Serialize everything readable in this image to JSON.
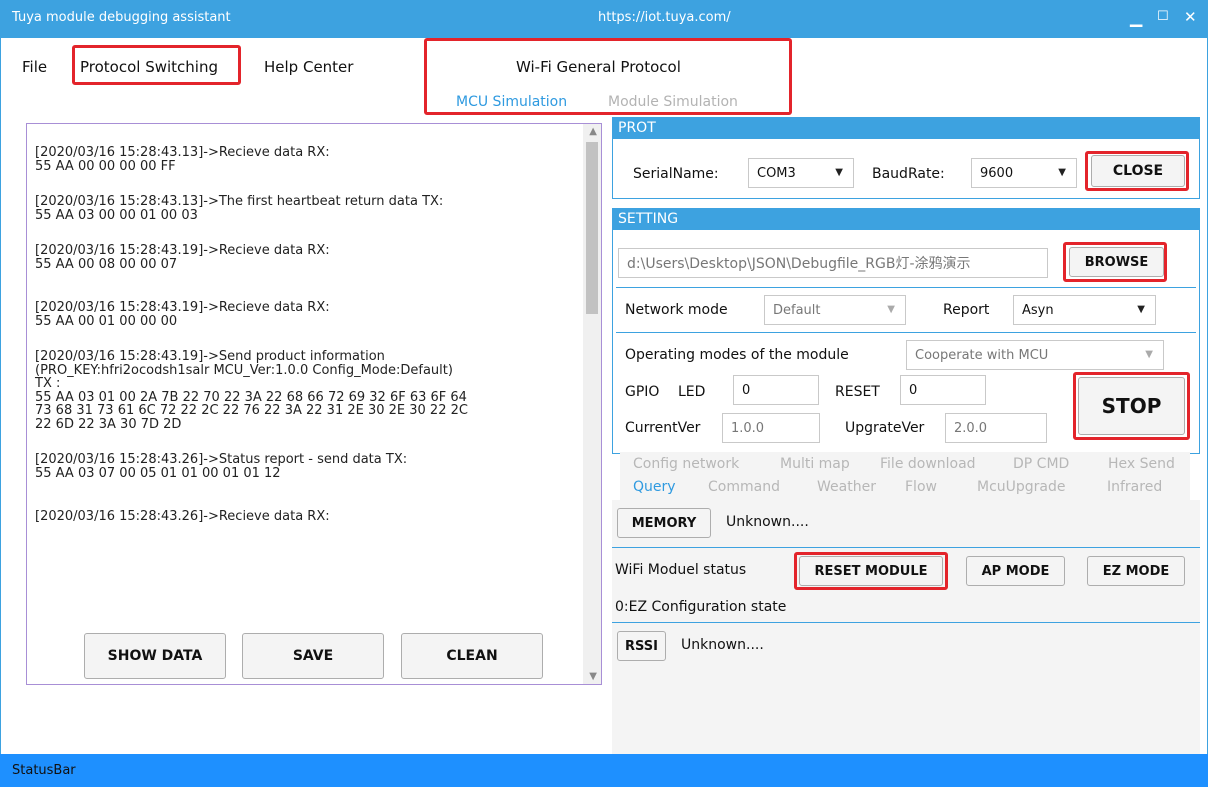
{
  "window": {
    "title": "Tuya module debugging assistant",
    "url": "https://iot.tuya.com/",
    "min_icon": "minimize-icon",
    "max_icon": "maximize-icon",
    "close_icon": "close-icon"
  },
  "menu": {
    "file": "File",
    "protocol_switching": "Protocol Switching",
    "help_center": "Help Center"
  },
  "protocol": {
    "title": "Wi-Fi General Protocol",
    "tabs": [
      "MCU Simulation",
      "Module Simulation"
    ]
  },
  "log": [
    "[2020/03/16 15:28:43.13]->Recieve data RX:\n55 AA 00 00 00 00 FF",
    "[2020/03/16 15:28:43.13]->The first heartbeat return data TX:\n55 AA 03 00 00 01 00 03",
    "[2020/03/16 15:28:43.19]->Recieve data RX:\n55 AA 00 08 00 00 07",
    "[2020/03/16 15:28:43.19]->Recieve data RX:\n55 AA 00 01 00 00 00",
    "[2020/03/16 15:28:43.19]->Send product information\n(PRO_KEY:hfri2ocodsh1salr MCU_Ver:1.0.0 Config_Mode:Default)\nTX :\n55 AA 03 01 00 2A 7B 22 70 22 3A 22 68 66 72 69 32 6F 63 6F 64\n73 68 31 73 61 6C 72 22 2C 22 76 22 3A 22 31 2E 30 2E 30 22 2C\n22 6D 22 3A 30 7D 2D",
    "[2020/03/16 15:28:43.26]->Status report - send data TX:\n55 AA 03 07 00 05 01 01 00 01 01 12",
    "[2020/03/16 15:28:43.26]->Recieve data RX:"
  ],
  "buttons": {
    "show_data": "SHOW DATA",
    "save": "SAVE",
    "clean": "CLEAN"
  },
  "prot": {
    "header": "PROT",
    "serial_label": "SerialName:",
    "serial_value": "COM3",
    "baud_label": "BaudRate:",
    "baud_value": "9600",
    "close": "CLOSE"
  },
  "setting": {
    "header": "SETTING",
    "file_path": "d:\\Users\\Desktop\\JSON\\Debugfile_RGB灯-涂鸦演示",
    "browse": "BROWSE",
    "network_mode_label": "Network mode",
    "network_mode_value": "Default",
    "report_label": "Report",
    "report_value": "Asyn",
    "operating_label": "Operating modes of the module",
    "operating_value": "Cooperate with MCU",
    "gpio_label": "GPIO",
    "led_label": "LED",
    "led_value": "0",
    "reset_label": "RESET",
    "reset_value": "0",
    "stop": "STOP",
    "current_ver_label": "CurrentVer",
    "current_ver_value": "1.0.0",
    "upgrade_ver_label": "UpgrateVer",
    "upgrade_ver_value": "2.0.0"
  },
  "func_tabs": {
    "row1": [
      "Config network",
      "Multi map",
      "File download",
      "DP CMD",
      "Hex Send"
    ],
    "row2": [
      "Query",
      "Command",
      "Weather",
      "Flow",
      "McuUpgrade",
      "Infrared"
    ],
    "active": "Query"
  },
  "query": {
    "memory_button": "MEMORY",
    "memory_value": "Unknown....",
    "wifi_status_label": "WiFi Moduel status",
    "reset_module": "RESET MODULE",
    "ap_mode": "AP MODE",
    "ez_mode": "EZ MODE",
    "config_state": "0:EZ Configuration state",
    "rssi_button": "RSSI",
    "rssi_value": "Unknown...."
  },
  "statusbar": "StatusBar",
  "colors": {
    "title_bar": "#3da2e0",
    "status_bar": "#1e90ff",
    "highlight_red": "#e3242b",
    "active_tab": "#2f9ae0"
  }
}
